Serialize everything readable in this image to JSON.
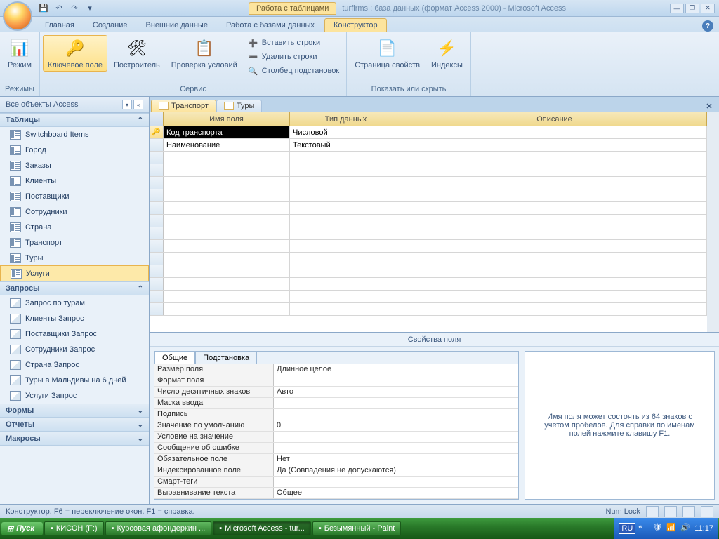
{
  "title": {
    "contextTab": "Работа с таблицами",
    "appTitle": "turfirms : база данных (формат Access 2000) - Microsoft Access"
  },
  "ribbonTabs": {
    "home": "Главная",
    "create": "Создание",
    "external": "Внешние данные",
    "dbtools": "Работа с базами данных",
    "designer": "Конструктор"
  },
  "ribbon": {
    "mode": "Режим",
    "modes": "Режимы",
    "keyField": "Ключевое поле",
    "builder": "Построитель",
    "validation": "Проверка условий",
    "insertRows": "Вставить строки",
    "deleteRows": "Удалить строки",
    "lookupCol": "Столбец подстановок",
    "tools": "Сервис",
    "propPage": "Страница свойств",
    "indexes": "Индексы",
    "showHide": "Показать или скрыть"
  },
  "nav": {
    "header": "Все объекты Access",
    "groups": {
      "tables": "Таблицы",
      "queries": "Запросы",
      "forms": "Формы",
      "reports": "Отчеты",
      "macros": "Макросы"
    },
    "tables": [
      "Switchboard Items",
      "Город",
      "Заказы",
      "Клиенты",
      "Поставщики",
      "Сотрудники",
      "Страна",
      "Транспорт",
      "Туры",
      "Услуги"
    ],
    "queries": [
      "Запрос по турам",
      "Клиенты Запрос",
      "Поставщики Запрос",
      "Сотрудники Запрос",
      "Страна Запрос",
      "Туры в Мальдивы на 6 дней",
      "Услуги Запрос"
    ]
  },
  "docTabs": {
    "t1": "Транспорт",
    "t2": "Туры"
  },
  "grid": {
    "hName": "Имя поля",
    "hType": "Тип данных",
    "hDesc": "Описание",
    "r1name": "Код транспорта",
    "r1type": "Числовой",
    "r2name": "Наименование",
    "r2type": "Текстовый"
  },
  "props": {
    "title": "Свойства поля",
    "tabGeneral": "Общие",
    "tabLookup": "Подстановка",
    "rows": {
      "size": {
        "n": "Размер поля",
        "v": "Длинное целое"
      },
      "format": {
        "n": "Формат поля",
        "v": ""
      },
      "decimals": {
        "n": "Число десятичных знаков",
        "v": "Авто"
      },
      "mask": {
        "n": "Маска ввода",
        "v": ""
      },
      "caption": {
        "n": "Подпись",
        "v": ""
      },
      "default": {
        "n": "Значение по умолчанию",
        "v": "0"
      },
      "valrule": {
        "n": "Условие на значение",
        "v": ""
      },
      "valtext": {
        "n": "Сообщение об ошибке",
        "v": ""
      },
      "required": {
        "n": "Обязательное поле",
        "v": "Нет"
      },
      "indexed": {
        "n": "Индексированное поле",
        "v": "Да (Совпадения не допускаются)"
      },
      "smarttags": {
        "n": "Смарт-теги",
        "v": ""
      },
      "align": {
        "n": "Выравнивание текста",
        "v": "Общее"
      }
    },
    "help": "Имя поля может состоять из 64 знаков с учетом пробелов.  Для справки по именам полей нажмите клавишу F1."
  },
  "status": {
    "left": "Конструктор.  F6 = переключение окон.  F1 = справка.",
    "numlock": "Num Lock"
  },
  "taskbar": {
    "start": "Пуск",
    "items": [
      "КИСОН (F:)",
      "Курсовая афондеркин ...",
      "Microsoft Access - tur...",
      "Безымянный - Paint"
    ],
    "lang": "RU",
    "time": "11:17"
  }
}
